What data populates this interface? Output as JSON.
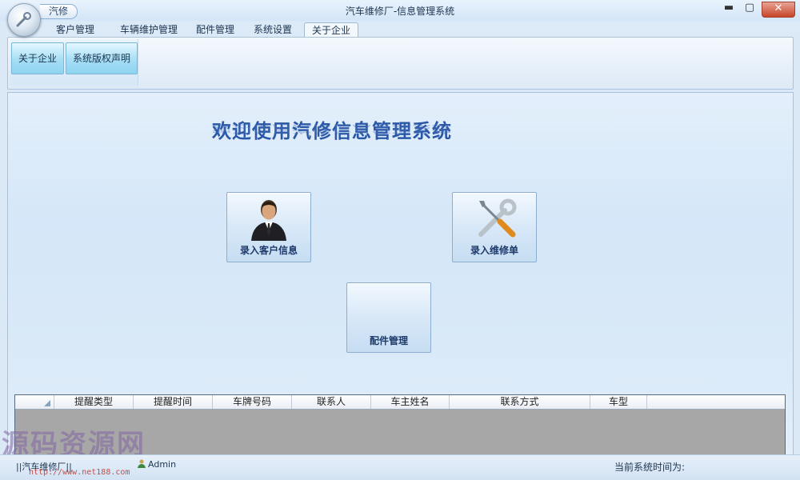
{
  "window": {
    "title": "汽车维修厂-信息管理系统",
    "quick_tab": "汽修",
    "min_glyph": "▬",
    "max_glyph": "▢",
    "close_glyph": "✕"
  },
  "tabs": [
    {
      "label": "客户管理"
    },
    {
      "label": "车辆维护管理"
    },
    {
      "label": "配件管理"
    },
    {
      "label": "系统设置"
    },
    {
      "label": "关于企业",
      "active": true
    }
  ],
  "ribbon": {
    "buttons": [
      {
        "label": "关于企业"
      },
      {
        "label": "系统版权声明"
      }
    ]
  },
  "main": {
    "welcome": "欢迎使用汽修信息管理系统",
    "tiles": [
      {
        "label": "录入客户信息",
        "icon": "businessman-icon"
      },
      {
        "label": "录入维修单",
        "icon": "tools-icon"
      },
      {
        "label": "配件管理",
        "icon": ""
      }
    ]
  },
  "grid": {
    "columns": [
      "提醒类型",
      "提醒时间",
      "车牌号码",
      "联系人",
      "车主姓名",
      "联系方式",
      "车型"
    ]
  },
  "status": {
    "left": "||汽车维修厂||",
    "user": "Admin",
    "right": "当前系统时间为:"
  },
  "watermark": {
    "text": "源码资源网",
    "url": "http://www.net188.com"
  }
}
